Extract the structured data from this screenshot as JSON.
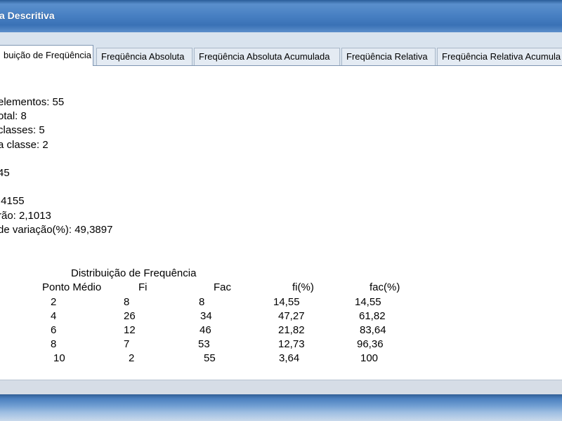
{
  "window": {
    "title": "a Descritiva"
  },
  "tabs": [
    {
      "label": "buição de Freqüência"
    },
    {
      "label": "Freqüência Absoluta"
    },
    {
      "label": "Freqüência Absoluta Acumulada"
    },
    {
      "label": "Freqüência Relativa"
    },
    {
      "label": "Freqüência Relativa Acumula"
    }
  ],
  "stats": {
    "line1": "elementos: 55",
    "line2": "otal: 8",
    "line3": "classes: 5",
    "line4": "a classe: 2",
    "line5": "45",
    "line6": ",4155",
    "line7": "rão: 2,1013",
    "line8": "de variação(%): 49,3897"
  },
  "distribution": {
    "title": "Distribuição de Frequência",
    "headers": [
      "Ponto Médio",
      "Fi",
      "Fac",
      "fi(%)",
      "fac(%)"
    ],
    "rows": [
      [
        "2",
        "8",
        "8",
        "14,55",
        "14,55"
      ],
      [
        "4",
        "26",
        "34",
        "47,27",
        "61,82"
      ],
      [
        "6",
        "12",
        "46",
        "21,82",
        "83,64"
      ],
      [
        "8",
        "7",
        "53",
        "12,73",
        "96,36"
      ],
      [
        "10",
        "2",
        "55",
        "3,64",
        "100"
      ]
    ]
  }
}
